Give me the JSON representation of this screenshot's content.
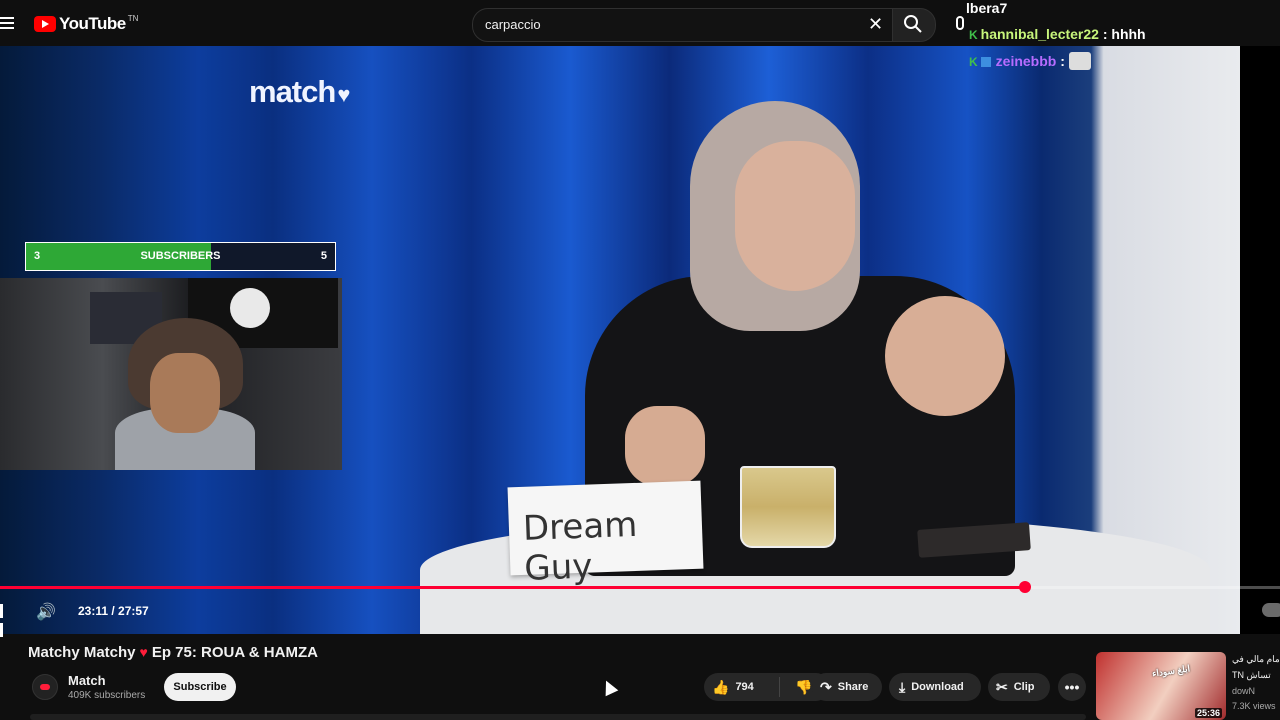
{
  "header": {
    "logo_text": "YouTube",
    "logo_country": "TN",
    "search_value": "carpaccio"
  },
  "video": {
    "brand_text": "match",
    "nameplate": "Dream Guy",
    "current_time": "23:11",
    "duration": "27:57",
    "time_display": "23:11 / 27:57",
    "progress_percent": 82.9
  },
  "overlay": {
    "subscriber_goal": {
      "left_value": "3",
      "label": "SUBSCRIBERS",
      "right_value": "5",
      "fill_percent": 60
    },
    "chat": [
      {
        "user": "lbera7",
        "message": ""
      },
      {
        "user": "hannibal_lecter22",
        "message": "hhhh"
      },
      {
        "user": "zeinebbb",
        "message": ""
      }
    ]
  },
  "info": {
    "title_part1": "Matchy Matchy",
    "title_part2": "Ep 75: ROUA & HAMZA",
    "channel_name": "Match",
    "channel_subs": "409K subscribers",
    "subscribe_label": "Subscribe",
    "like_count": "794",
    "share_label": "Share",
    "download_label": "Download",
    "clip_label": "Clip"
  },
  "suggested": {
    "title": "أمام مالي في",
    "channel": "TN تساش",
    "meta": "dowN",
    "views": "7.3K views",
    "duration": "25:36",
    "thumb_text": "ابلغ سوداء"
  },
  "colors": {
    "accent_red": "#ff0033",
    "subscriber_green": "#2ea836",
    "background": "#0f0f0f"
  }
}
